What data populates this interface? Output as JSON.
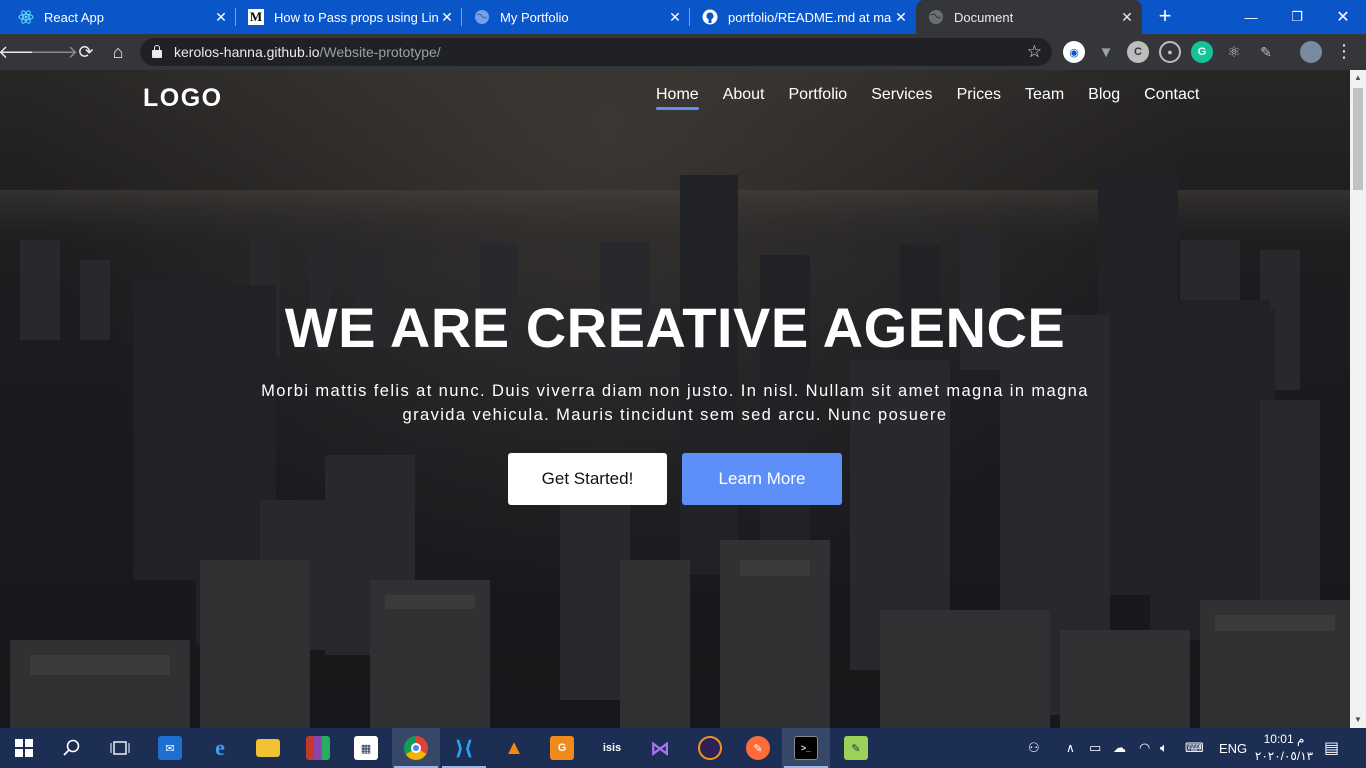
{
  "browser": {
    "tabs": [
      {
        "title": "React App",
        "icon": "react-icon",
        "color": "#61dafb"
      },
      {
        "title": "How to Pass props using Link a",
        "icon": "medium-icon",
        "color": "#000000"
      },
      {
        "title": "My Portfolio",
        "icon": "globe-icon",
        "color": "#9aa0a6"
      },
      {
        "title": "portfolio/README.md at maste",
        "icon": "github-icon",
        "color": "#ffffff"
      },
      {
        "title": "Document",
        "icon": "globe-icon",
        "color": "#9aa0a6",
        "active": true
      }
    ],
    "address": {
      "host": "kerolos-hanna.github.io",
      "path": "/Website-prototype/"
    },
    "colors": {
      "tabstrip": "#0a56c9",
      "toolbar": "#35363a",
      "omnibox": "#202124"
    }
  },
  "website": {
    "logo": "LOGO",
    "nav": [
      "Home",
      "About",
      "Portfolio",
      "Services",
      "Prices",
      "Team",
      "Blog",
      "Contact"
    ],
    "active_nav": "Home",
    "hero": {
      "title": "WE ARE CREATIVE AGENCE",
      "subtitle": "Morbi mattis felis at nunc. Duis viverra diam non justo. In nisl. Nullam sit amet magna in magna gravida vehicula. Mauris tincidunt sem sed arcu. Nunc posuere",
      "primary_button": "Get Started!",
      "secondary_button": "Learn More"
    },
    "colors": {
      "accent": "#5e8ef7",
      "text": "#ffffff"
    }
  },
  "taskbar": {
    "tray_language": "ENG",
    "clock_time": "10:01 م",
    "clock_date": "٢٠٢٠/٠٥/١٣"
  }
}
